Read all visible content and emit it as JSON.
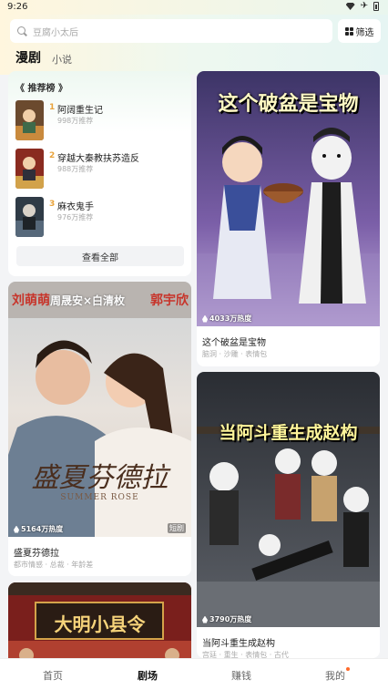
{
  "status_bar": {
    "time": "9:26"
  },
  "search": {
    "placeholder": "豆腐小太后"
  },
  "filter": {
    "label": "筛选",
    "icon": "grid-icon"
  },
  "tabs": [
    {
      "label": "漫剧",
      "active": true
    },
    {
      "label": "小说",
      "active": false
    }
  ],
  "ranking": {
    "title": "《 推荐榜 》",
    "items": [
      {
        "rank": "1",
        "name": "阿阔重生记",
        "heat": "998万推荐"
      },
      {
        "rank": "2",
        "name": "穿越大秦教扶苏造反",
        "heat": "988万推荐"
      },
      {
        "rank": "3",
        "name": "麻衣鬼手",
        "heat": "976万推荐"
      }
    ],
    "view_all_label": "查看全部"
  },
  "cards": [
    {
      "id": "basin",
      "poster_text": "这个破盆是宝物",
      "heat": "4033万热度",
      "title": "这个破盆是宝物",
      "tags": "脑洞 · 沙雕 · 表情包"
    },
    {
      "id": "summer-rose",
      "poster_names": [
        "刘萌萌",
        "周晟安×白清枚",
        "郭宇欣"
      ],
      "poster_title": "盛夏芬德拉",
      "poster_subtitle": "SUMMER ROSE",
      "heat": "5164万热度",
      "badge": "短剧",
      "title": "盛夏芬德拉",
      "tags": "都市情感 · 总裁 · 年龄差"
    },
    {
      "id": "adou",
      "poster_text": "当阿斗重生成赵构",
      "heat": "3790万热度",
      "title": "当阿斗重生成赵构",
      "tags": "宫廷 · 重生 · 表情包 · 古代"
    },
    {
      "id": "daming",
      "poster_text": "大明小县令"
    }
  ],
  "bottom_nav": [
    {
      "label": "首页",
      "active": false
    },
    {
      "label": "剧场",
      "active": true
    },
    {
      "label": "赚钱",
      "active": false
    },
    {
      "label": "我的",
      "active": false,
      "dot": true
    }
  ],
  "colors": {
    "accent": "#e8a23a",
    "dot": "#ff6a2a"
  }
}
